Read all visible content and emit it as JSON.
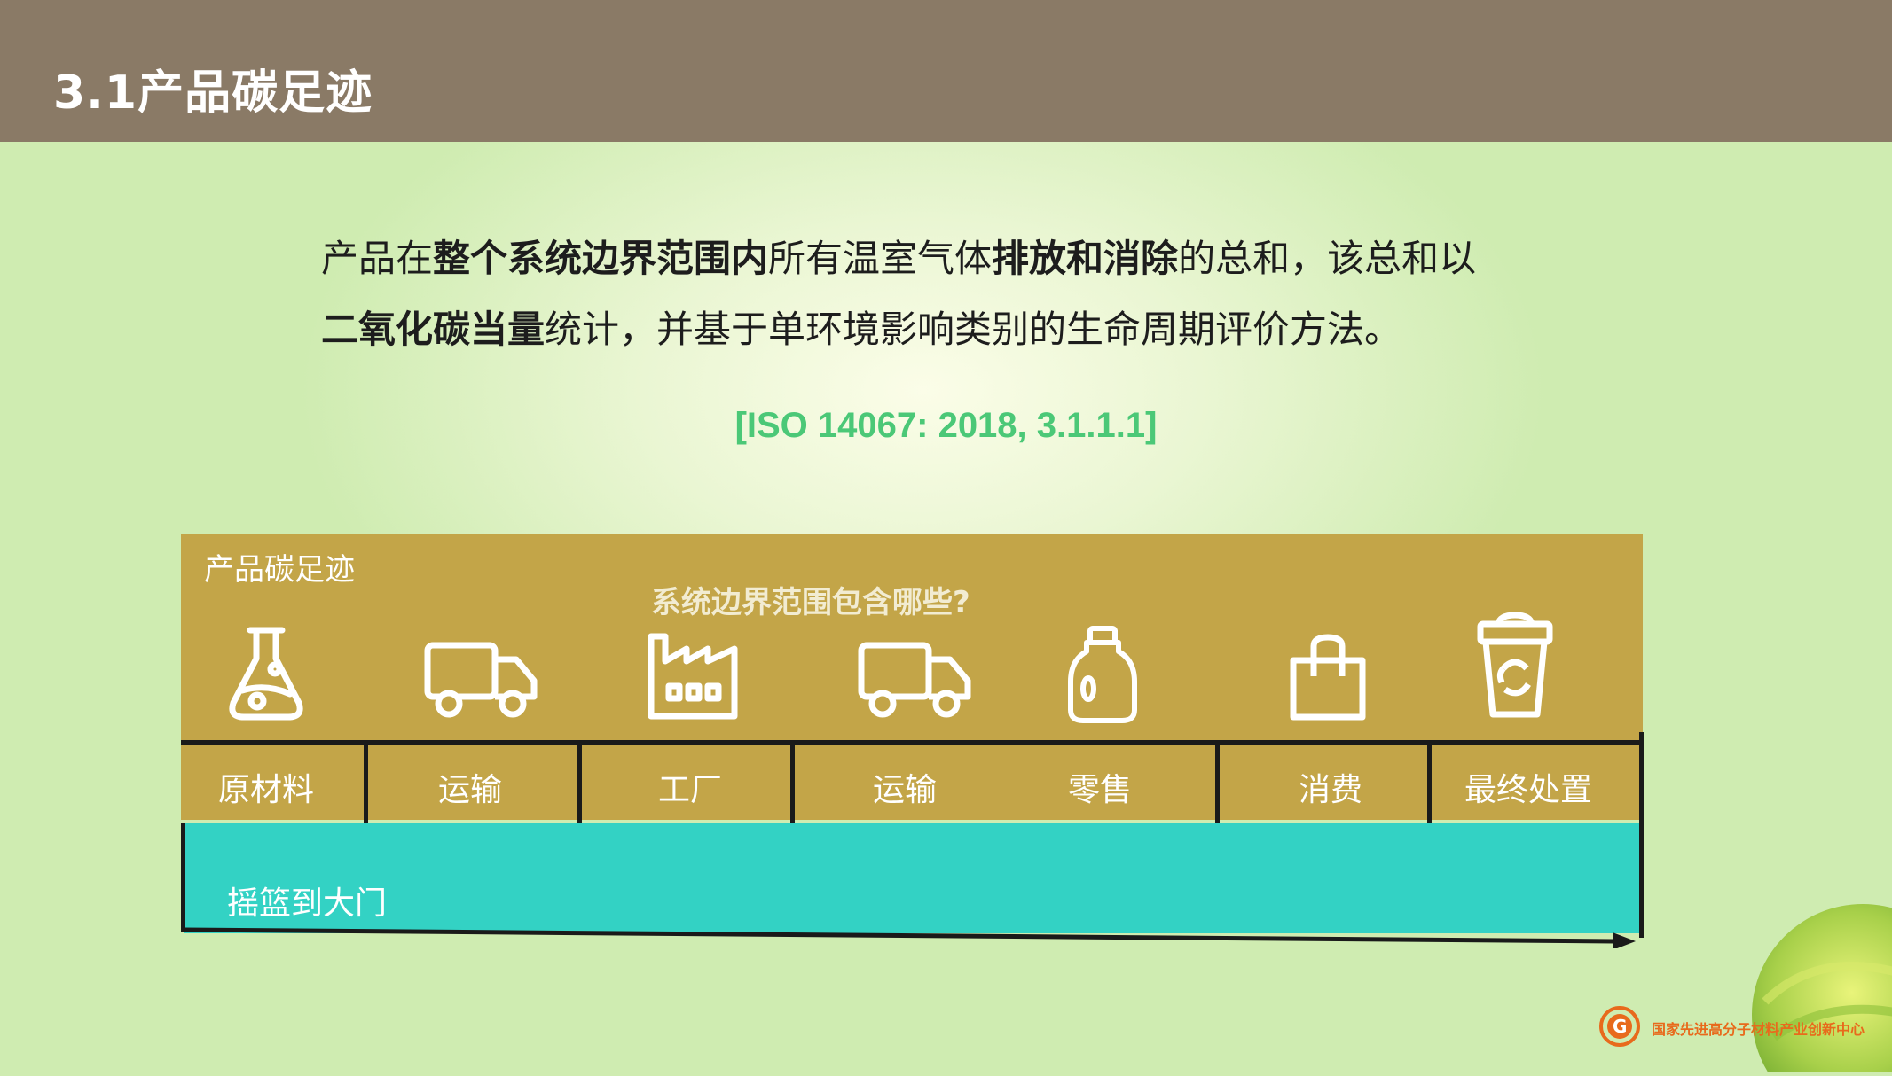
{
  "header": {
    "title": "3.1产品碳足迹"
  },
  "definition": {
    "p1": "产品在",
    "b1": "整个系统边界范围内",
    "p2": "所有温室气体",
    "b2": "排放和消除",
    "p3": "的总和，该总和以",
    "b3": "二氧化碳当量",
    "p4": "统计，并基于单环境影响类别的生命周期评价方法。"
  },
  "citation": "[ISO 14067: 2018, 3.1.1.1]",
  "diagram": {
    "label": "产品碳足迹",
    "question": "系统边界范围包含哪些?",
    "stages": [
      "原材料",
      "运输",
      "工厂",
      "运输",
      "零售",
      "消费",
      "最终处置"
    ],
    "icons": [
      "flask-icon",
      "truck-icon",
      "factory-icon",
      "truck-icon",
      "bottle-icon",
      "shopping-bag-icon",
      "recycle-cup-icon"
    ],
    "scope_label": "摇篮到大门",
    "colors": {
      "gold": "#c3a548",
      "teal": "#33d2c4",
      "citation": "#4bc877"
    }
  },
  "footer": {
    "logo_text": "国家先进高分子材料产业创新中心"
  }
}
